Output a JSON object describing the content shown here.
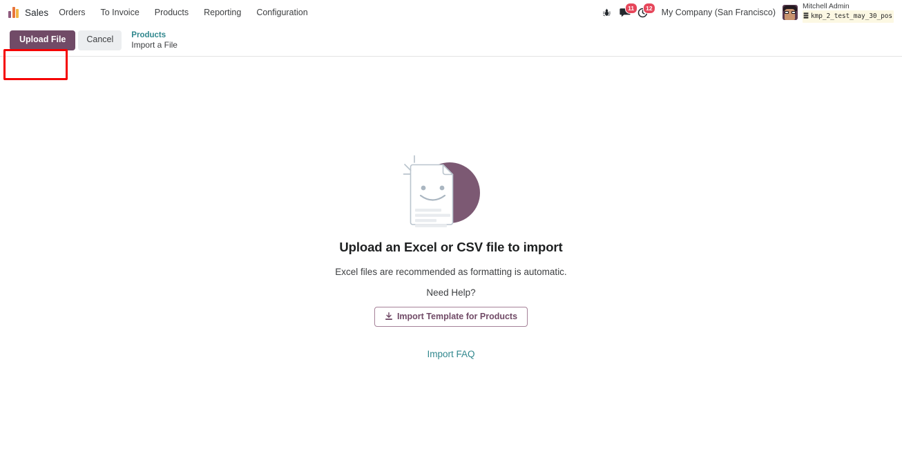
{
  "navbar": {
    "brand": "Sales",
    "logo_icon": "odoo-bars-logo-icon",
    "menu_items": [
      {
        "label": "Orders"
      },
      {
        "label": "To Invoice"
      },
      {
        "label": "Products"
      },
      {
        "label": "Reporting"
      },
      {
        "label": "Configuration"
      }
    ],
    "system_icons": [
      {
        "name": "bug-icon",
        "badge": ""
      },
      {
        "name": "messages-icon",
        "badge": "11"
      },
      {
        "name": "activities-clock-icon",
        "badge": "12"
      }
    ],
    "company": "My Company (San Francisco)",
    "user": {
      "name": "Mitchell Admin",
      "database": "kmp_2_test_may_30_pos",
      "db_icon": "database-icon",
      "avatar_icon": "user-avatar"
    }
  },
  "control_panel": {
    "upload_label": "Upload File",
    "cancel_label": "Cancel",
    "breadcrumb_parent": "Products",
    "breadcrumb_current": "Import a File"
  },
  "main": {
    "illustration_icon": "smiling-document-upload-illustration",
    "headline": "Upload an Excel or CSV file to import",
    "subline": "Excel files are recommended as formatting is automatic.",
    "need_help": "Need Help?",
    "template_button": "Import Template for Products",
    "template_icon": "download-icon",
    "faq_link": "Import FAQ"
  },
  "colors": {
    "primary": "#714b67",
    "link": "#30878d",
    "badge": "#e6475b",
    "annotation": "#f50000",
    "text": "#3c3e40"
  }
}
